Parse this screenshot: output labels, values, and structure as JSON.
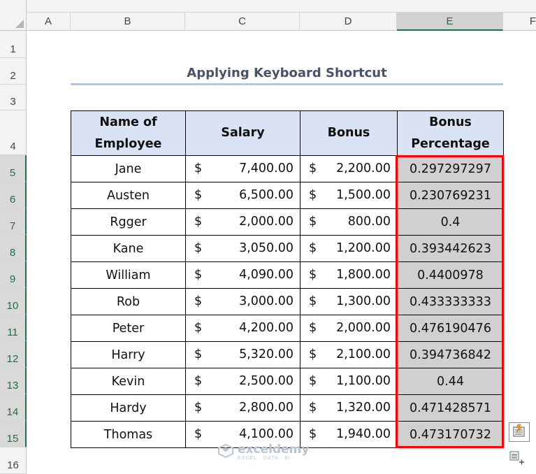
{
  "spreadsheet": {
    "columns": [
      "A",
      "B",
      "C",
      "D",
      "E",
      "F"
    ],
    "rows": [
      "1",
      "2",
      "3",
      "4",
      "5",
      "6",
      "7",
      "8",
      "9",
      "10",
      "11",
      "12",
      "13",
      "14",
      "15",
      "16"
    ],
    "selected_column": "E",
    "selected_rows": "5-15"
  },
  "title": "Applying Keyboard Shortcut",
  "table": {
    "headers": [
      "Name of Employee",
      "Salary",
      "Bonus",
      "Bonus Percentage"
    ],
    "currency_symbol": "$",
    "rows": [
      {
        "name": "Jane",
        "salary": "7,400.00",
        "bonus": "2,200.00",
        "pct": "0.297297297"
      },
      {
        "name": "Austen",
        "salary": "6,500.00",
        "bonus": "1,500.00",
        "pct": "0.230769231"
      },
      {
        "name": "Rgger",
        "salary": "2,000.00",
        "bonus": "800.00",
        "pct": "0.4"
      },
      {
        "name": "Kane",
        "salary": "3,050.00",
        "bonus": "1,200.00",
        "pct": "0.393442623"
      },
      {
        "name": "William",
        "salary": "4,090.00",
        "bonus": "1,800.00",
        "pct": "0.4400978"
      },
      {
        "name": "Rob",
        "salary": "3,000.00",
        "bonus": "1,300.00",
        "pct": "0.433333333"
      },
      {
        "name": "Peter",
        "salary": "4,200.00",
        "bonus": "2,000.00",
        "pct": "0.476190476"
      },
      {
        "name": "Harry",
        "salary": "5,320.00",
        "bonus": "2,100.00",
        "pct": "0.394736842"
      },
      {
        "name": "Kevin",
        "salary": "2,500.00",
        "bonus": "1,100.00",
        "pct": "0.44"
      },
      {
        "name": "Hardy",
        "salary": "2,800.00",
        "bonus": "1,320.00",
        "pct": "0.471428571"
      },
      {
        "name": "Thomas",
        "salary": "4,100.00",
        "bonus": "1,940.00",
        "pct": "0.473170732"
      }
    ]
  },
  "watermark": {
    "name": "exceldemy",
    "tagline": "EXCEL · DATA · BI"
  },
  "icons": {
    "quick_analysis": "quick-analysis-icon",
    "paste_options": "paste-options-icon"
  },
  "colors": {
    "highlight_border": "#ff0000",
    "header_fill": "#dae3f3",
    "selection_fill": "#d0d0d0",
    "excel_green": "#217346"
  }
}
